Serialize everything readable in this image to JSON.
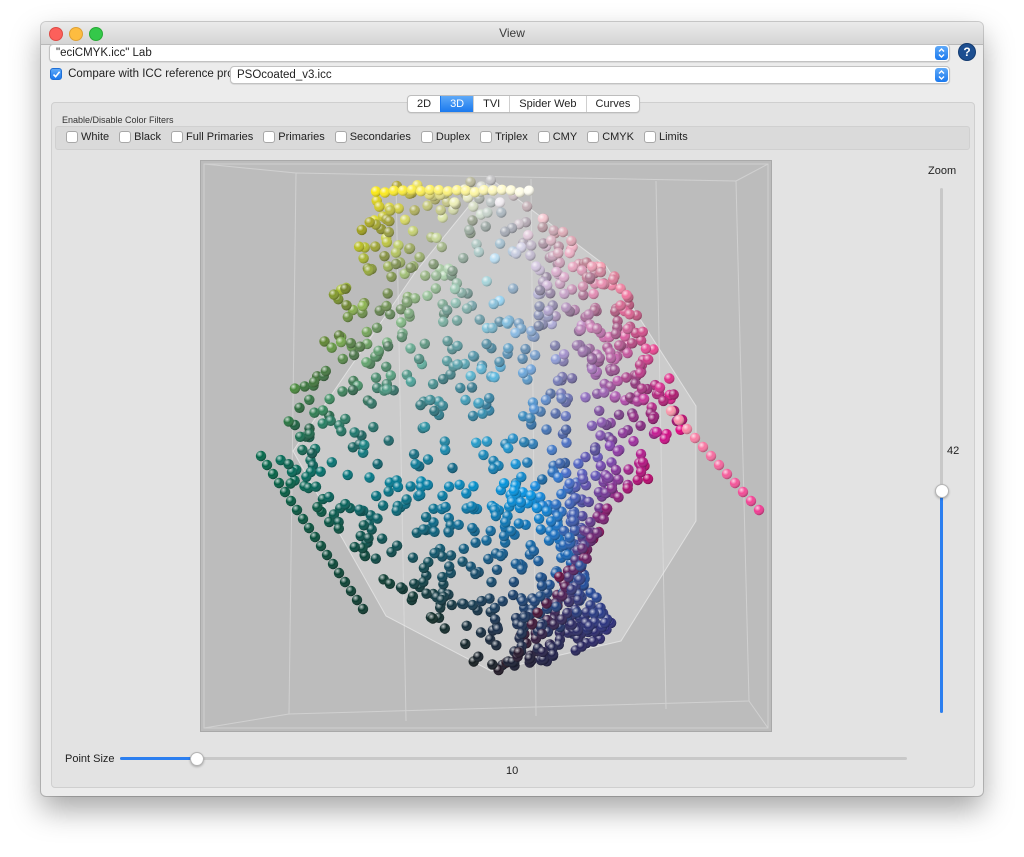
{
  "window": {
    "title": "View"
  },
  "profile_select": {
    "value": "\"eciCMYK.icc\" Lab"
  },
  "help": {
    "label": "?"
  },
  "compare": {
    "label": "Compare with ICC reference profile:",
    "checked": true,
    "reference_value": "PSOcoated_v3.icc"
  },
  "tabs": [
    {
      "label": "2D",
      "active": false
    },
    {
      "label": "3D",
      "active": true
    },
    {
      "label": "TVI",
      "active": false
    },
    {
      "label": "Spider Web",
      "active": false
    },
    {
      "label": "Curves",
      "active": false
    }
  ],
  "filters": {
    "title": "Enable/Disable Color Filters",
    "items": [
      {
        "label": "White",
        "checked": false
      },
      {
        "label": "Black",
        "checked": false
      },
      {
        "label": "Full Primaries",
        "checked": false
      },
      {
        "label": "Primaries",
        "checked": false
      },
      {
        "label": "Secondaries",
        "checked": false
      },
      {
        "label": "Duplex",
        "checked": false
      },
      {
        "label": "Triplex",
        "checked": false
      },
      {
        "label": "CMY",
        "checked": false
      },
      {
        "label": "CMYK",
        "checked": false
      },
      {
        "label": "Limits",
        "checked": false
      }
    ]
  },
  "zoom": {
    "label": "Zoom",
    "value": "42",
    "fraction": 0.42
  },
  "point_size": {
    "label": "Point Size",
    "value": "10",
    "fraction": 0.1
  },
  "colors": {
    "accent": "#2c7ff0",
    "viewport_bg": "#bcbcbc"
  }
}
